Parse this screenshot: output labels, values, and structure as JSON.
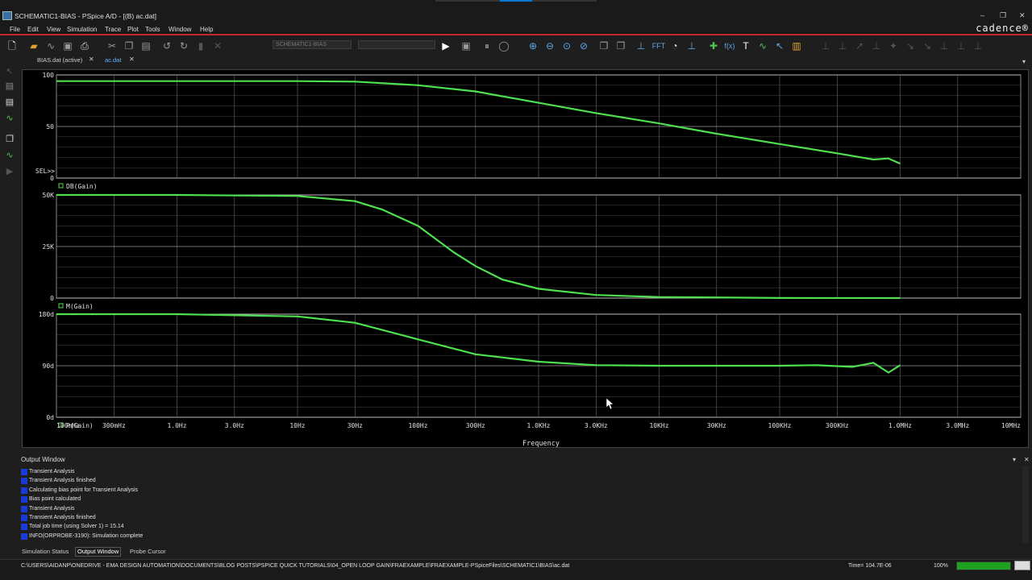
{
  "window": {
    "title": "SCHEMATIC1-BIAS - PSpice A/D  - [(B) ac.dat]",
    "controls": {
      "minimize": "–",
      "restore": "❐",
      "close": "✕"
    }
  },
  "menubar": {
    "items": [
      "File",
      "Edit",
      "View",
      "Simulation",
      "Trace",
      "Plot",
      "Tools",
      "Window",
      "Help"
    ],
    "brand": "cadence®"
  },
  "toolbar": {
    "profile_select": "SCHEMATIC1-BIAS",
    "fft_label": "FFT"
  },
  "tabs": [
    {
      "label": "BIAS.dat (active)",
      "close": "✕"
    },
    {
      "label": "ac.dat",
      "close": "✕"
    }
  ],
  "colors": {
    "accent": "#c4262e",
    "trace": "#4fe04f",
    "tab_active": "#5fb3ff",
    "status_green": "#20a020"
  },
  "plot": {
    "x_axis_label": "Frequency",
    "x_ticks": [
      "100mHz",
      "300mHz",
      "1.0Hz",
      "3.0Hz",
      "10Hz",
      "30Hz",
      "100Hz",
      "300Hz",
      "1.0KHz",
      "3.0KHz",
      "10KHz",
      "30KHz",
      "100KHz",
      "300KHz",
      "1.0MHz",
      "3.0MHz",
      "10MHz"
    ],
    "sel_marker": "SEL>>",
    "panels": [
      {
        "trace_label": "DB(Gain)",
        "y_ticks": [
          "100",
          "50",
          "0"
        ]
      },
      {
        "trace_label": "M(Gain)",
        "y_ticks": [
          "50K",
          "25K",
          "0"
        ]
      },
      {
        "trace_label": "P(Gain)",
        "y_ticks": [
          "180d",
          "90d",
          "0d"
        ]
      }
    ]
  },
  "chart_data": [
    {
      "type": "line",
      "series": [
        {
          "name": "DB(Gain)"
        }
      ],
      "x": [
        0.1,
        1,
        10,
        30,
        100,
        300,
        1000,
        3000,
        10000,
        30000,
        100000,
        300000,
        600000,
        800000,
        1000000
      ],
      "values": [
        94,
        94,
        94,
        93.5,
        90,
        84,
        73,
        63,
        53,
        43,
        33,
        24,
        18,
        19,
        14
      ],
      "ylim": [
        0,
        100
      ],
      "log_x": true,
      "grid": true
    },
    {
      "type": "line",
      "series": [
        {
          "name": "M(Gain)"
        }
      ],
      "x": [
        0.1,
        1,
        10,
        30,
        50,
        100,
        200,
        300,
        500,
        1000,
        3000,
        10000,
        100000,
        1000000
      ],
      "values": [
        50000,
        50000,
        49500,
        47000,
        43000,
        35000,
        22000,
        15500,
        9000,
        4500,
        1500,
        500,
        50,
        5
      ],
      "ylim": [
        0,
        50000
      ],
      "log_x": true,
      "grid": true
    },
    {
      "type": "line",
      "series": [
        {
          "name": "P(Gain)"
        }
      ],
      "x": [
        0.1,
        1,
        10,
        30,
        100,
        300,
        1000,
        3000,
        10000,
        100000,
        200000,
        400000,
        600000,
        800000,
        1000000
      ],
      "values": [
        180,
        180,
        176,
        165,
        136,
        110,
        97,
        91,
        90,
        90,
        91,
        88,
        95,
        78,
        91
      ],
      "ylim": [
        0,
        180
      ],
      "log_x": true,
      "grid": true
    }
  ],
  "output_window": {
    "title": "Output Window",
    "controls": {
      "dropdown": "▾",
      "close": "✕"
    },
    "lines": [
      "Transient Analysis",
      "Transient Analysis finished",
      "Calculating bias point for Transient Analysis",
      "Bias point calculated",
      "Transient Analysis",
      "Transient Analysis finished",
      " Total job time (using Solver 1)   =     15.14",
      "INFO(ORPROBE-3190): Simulation complete"
    ]
  },
  "bottom_tabs": [
    "Simulation Status",
    "Output Window",
    "Probe Cursor"
  ],
  "statusbar": {
    "path": "C:\\USERS\\AIDANP\\ONEDRIVE - EMA DESIGN AUTOMATION\\DOCUMENTS\\BLOG POSTS\\PSPICE QUICK TUTORIALS\\04_OPEN LOOP GAIN\\FRAEXAMPLE\\FRAEXAMPLE-PSpiceFiles\\SCHEMATIC1\\BIAS\\ac.dat",
    "time": "Time= 104.7E-06",
    "zoom": "100%"
  }
}
